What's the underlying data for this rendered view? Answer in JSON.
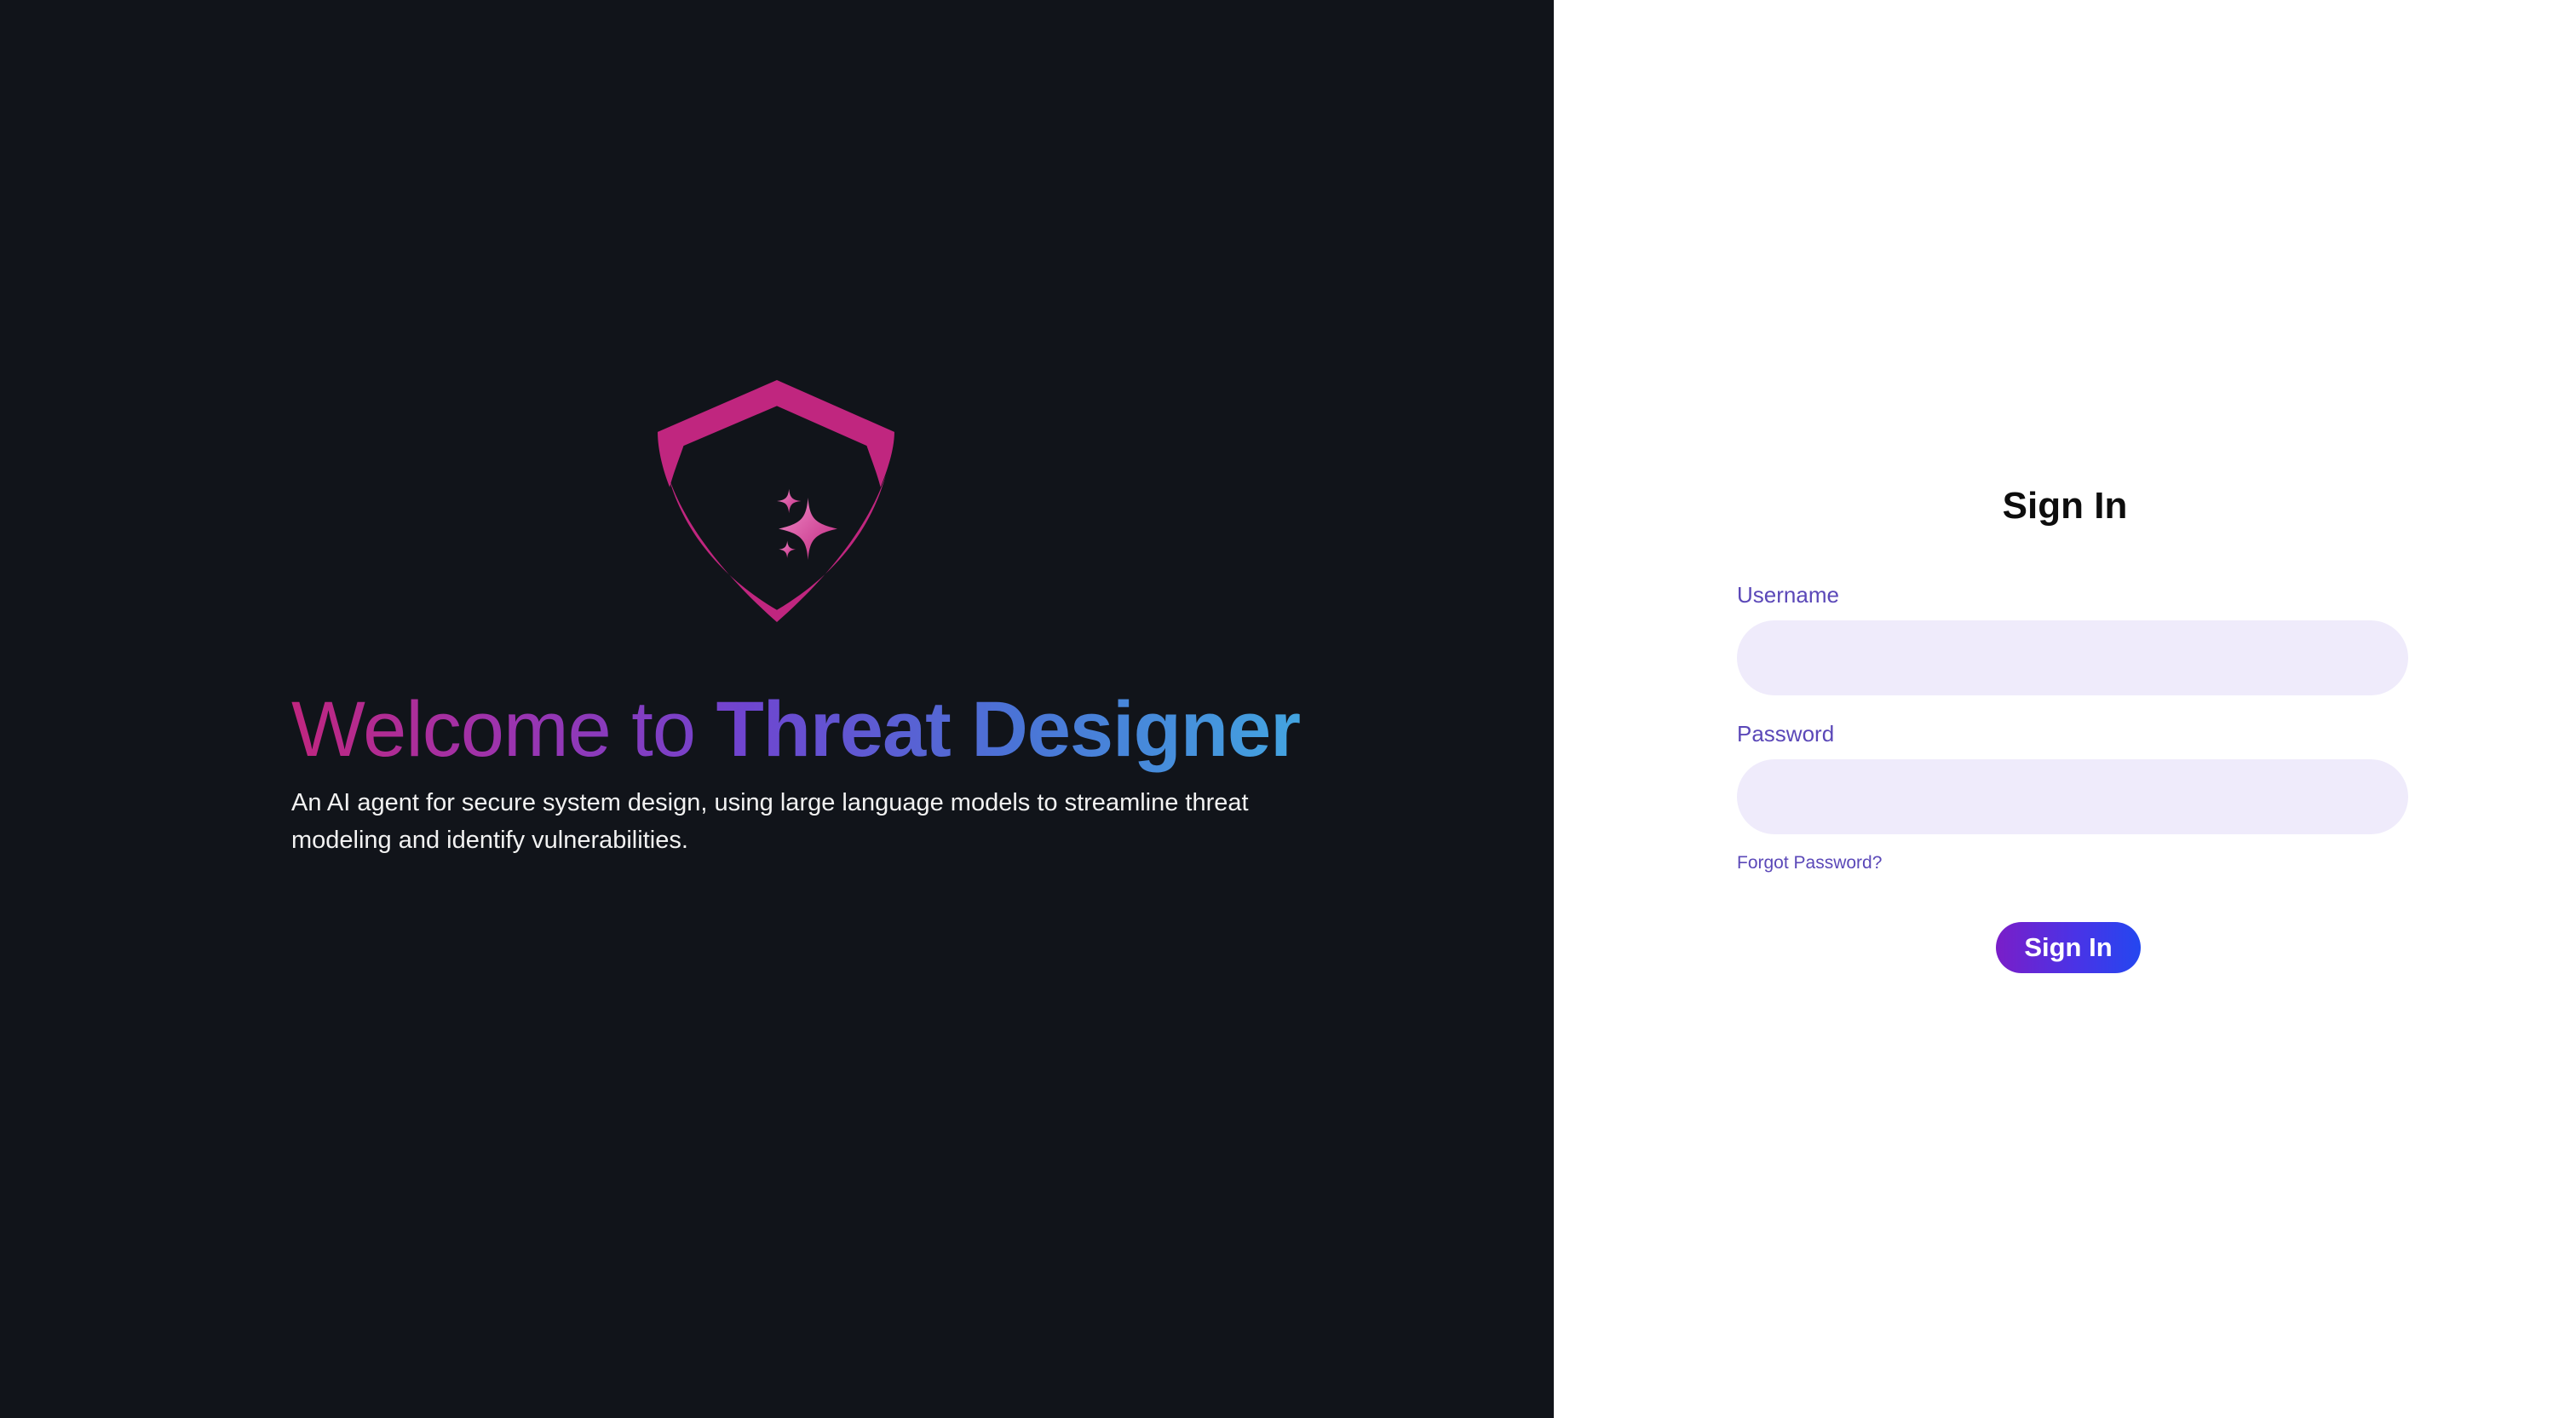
{
  "hero": {
    "title_light": "Welcome to ",
    "title_bold": "Threat Designer",
    "subtitle": "An AI agent for secure system design, using large language models to streamline threat modeling and identify vulnerabilities.",
    "logo_icon": "shield-sparkle-icon"
  },
  "signin": {
    "title": "Sign In",
    "username_label": "Username",
    "username_value": "",
    "password_label": "Password",
    "password_value": "",
    "forgot_password": "Forgot Password?",
    "button_label": "Sign In"
  },
  "colors": {
    "left_background": "#11141a",
    "right_background": "#ffffff",
    "logo_magenta": "#c0267f",
    "label_purple": "#5b48b8",
    "input_fill": "#efebfb",
    "button_gradient_start": "#7a1ec8",
    "button_gradient_end": "#2447f0"
  }
}
